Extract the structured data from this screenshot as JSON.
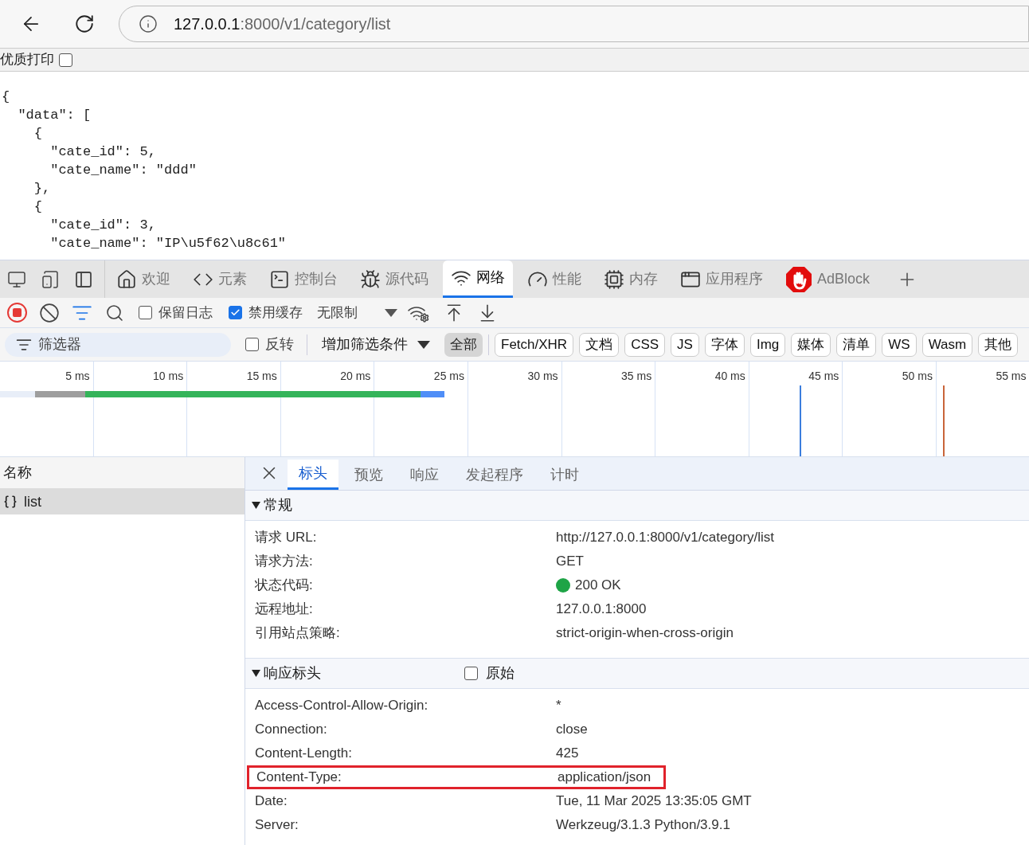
{
  "browser": {
    "url_host": "127.0.0.1",
    "url_path": ":8000/v1/category/list"
  },
  "print_bar": {
    "label": "优质打印",
    "checked": false
  },
  "json_lines": [
    "{",
    "  \"data\": [",
    "    {",
    "      \"cate_id\": 5,",
    "      \"cate_name\": \"ddd\"",
    "    },",
    "    {",
    "      \"cate_id\": 3,",
    "      \"cate_name\": \"IP\\u5f62\\u8c61\""
  ],
  "devtools": {
    "tabs": [
      {
        "kind": "home",
        "label": "欢迎",
        "selected": false
      },
      {
        "kind": "code",
        "label": "元素",
        "selected": false
      },
      {
        "kind": "terminal",
        "label": "控制台",
        "selected": false
      },
      {
        "kind": "bug",
        "label": "源代码",
        "selected": false
      },
      {
        "kind": "wifi",
        "label": "网络",
        "selected": true
      },
      {
        "kind": "gauge",
        "label": "性能",
        "selected": false
      },
      {
        "kind": "chip",
        "label": "内存",
        "selected": false
      },
      {
        "kind": "window",
        "label": "应用程序",
        "selected": false
      },
      {
        "kind": "adblock",
        "label": "AdBlock",
        "selected": false
      }
    ],
    "toolbar": {
      "recording": true,
      "preserve_log": {
        "label": "保留日志",
        "checked": false
      },
      "disable_cache": {
        "label": "禁用缓存",
        "checked": true
      },
      "throttle": "无限制"
    },
    "filter": {
      "placeholder": "筛选器",
      "invert": {
        "label": "反转",
        "checked": false
      },
      "more": "增加筛选条件",
      "types": [
        {
          "label": "全部",
          "selected": true
        },
        {
          "label": "Fetch/XHR",
          "selected": false
        },
        {
          "label": "文档",
          "selected": false
        },
        {
          "label": "CSS",
          "selected": false
        },
        {
          "label": "JS",
          "selected": false
        },
        {
          "label": "字体",
          "selected": false
        },
        {
          "label": "Img",
          "selected": false
        },
        {
          "label": "媒体",
          "selected": false
        },
        {
          "label": "清单",
          "selected": false
        },
        {
          "label": "WS",
          "selected": false
        },
        {
          "label": "Wasm",
          "selected": false
        },
        {
          "label": "其他",
          "selected": false
        }
      ]
    }
  },
  "timeline_ticks": [
    "5 ms",
    "10 ms",
    "15 ms",
    "20 ms",
    "25 ms",
    "30 ms",
    "35 ms",
    "40 ms",
    "45 ms",
    "50 ms",
    "55 ms"
  ],
  "requests": {
    "header": "名称",
    "rows": [
      {
        "name": "list",
        "selected": true
      }
    ]
  },
  "detail_tabs": [
    {
      "label": "标头",
      "selected": true
    },
    {
      "label": "预览",
      "selected": false
    },
    {
      "label": "响应",
      "selected": false
    },
    {
      "label": "发起程序",
      "selected": false
    },
    {
      "label": "计时",
      "selected": false
    }
  ],
  "general": {
    "title": "常规",
    "expanded": true,
    "rows": [
      {
        "key": "请求 URL:",
        "value": "http://127.0.0.1:8000/v1/category/list"
      },
      {
        "key": "请求方法:",
        "value": "GET"
      },
      {
        "key": "状态代码:",
        "value": "200 OK",
        "color": "#1ea446"
      },
      {
        "key": "远程地址:",
        "value": "127.0.0.1:8000"
      },
      {
        "key": "引用站点策略:",
        "value": "strict-origin-when-cross-origin"
      }
    ]
  },
  "response_headers": {
    "title": "响应标头",
    "expanded": true,
    "raw": {
      "label": "原始",
      "checked": false
    },
    "rows": [
      {
        "key": "Access-Control-Allow-Origin:",
        "value": "*",
        "highlighted": false
      },
      {
        "key": "Connection:",
        "value": "close",
        "highlighted": false
      },
      {
        "key": "Content-Length:",
        "value": "425",
        "highlighted": false
      },
      {
        "key": "Content-Type:",
        "value": "application/json",
        "highlighted": true
      },
      {
        "key": "Date:",
        "value": "Tue, 11 Mar 2025 13:35:05 GMT",
        "highlighted": false
      },
      {
        "key": "Server:",
        "value": "Werkzeug/3.1.3 Python/3.9.1",
        "highlighted": false
      }
    ]
  }
}
